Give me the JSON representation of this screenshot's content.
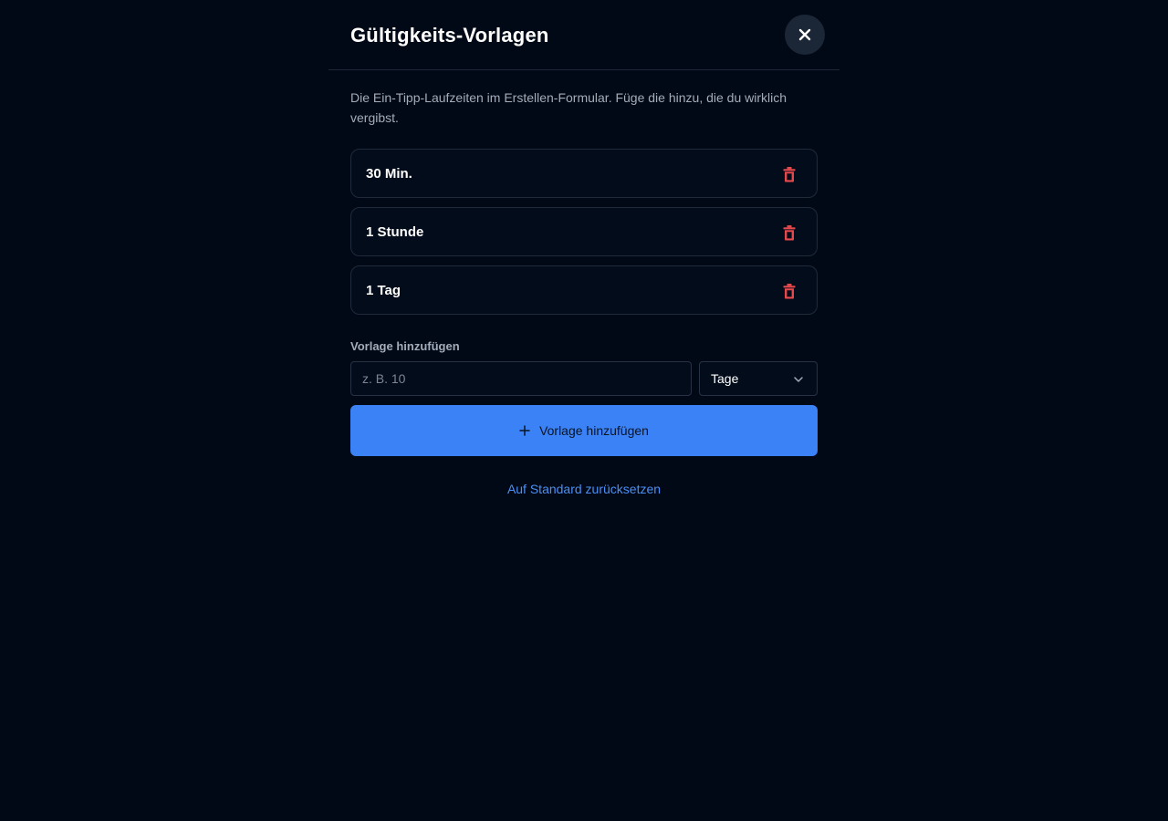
{
  "dialog": {
    "title": "Gültigkeits-Vorlagen",
    "close_icon": "close-icon",
    "description": "Die Ein-Tipp-Laufzeiten im Erstellen-Formular. Füge die hinzu, die du wirklich vergibst."
  },
  "templates": [
    {
      "label": "30 Min.",
      "delete_icon": "trash-icon"
    },
    {
      "label": "1 Stunde",
      "delete_icon": "trash-icon"
    },
    {
      "label": "1 Tag",
      "delete_icon": "trash-icon"
    }
  ],
  "add_form": {
    "section_label": "Vorlage hinzufügen",
    "amount_value": "",
    "amount_placeholder": "z. B. 10",
    "unit_selected": "Tage",
    "submit_label": "Vorlage hinzufügen",
    "submit_icon": "plus-icon"
  },
  "reset_link": "Auf Standard zurücksetzen",
  "colors": {
    "background": "#020916",
    "accent": "#3b82f6",
    "danger": "#e5484d",
    "link": "#4a8ff5"
  }
}
